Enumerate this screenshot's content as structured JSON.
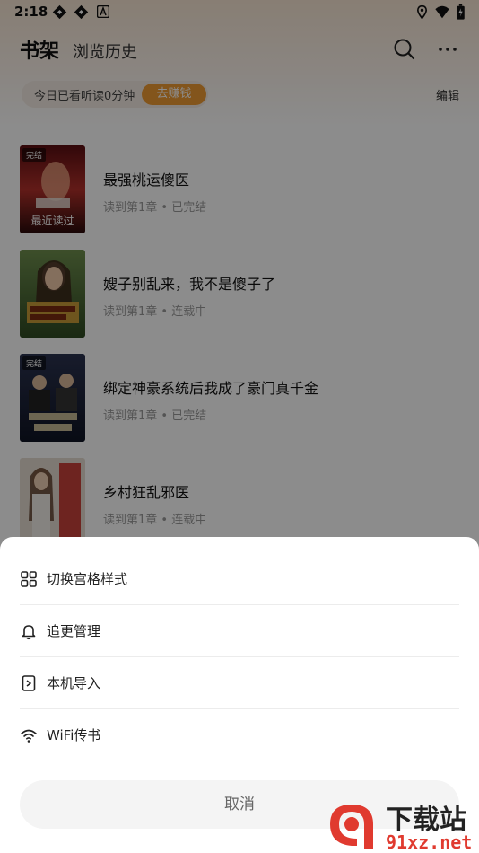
{
  "status_bar": {
    "time": "2:18",
    "left_icons": [
      "sync-icon",
      "sync-icon",
      "notification-a-icon"
    ],
    "right_icons": [
      "location-icon",
      "wifi-icon",
      "battery-icon"
    ]
  },
  "header": {
    "tab_active": "书架",
    "tab_inactive": "浏览历史",
    "search_icon": "search-icon",
    "more_icon": "more-icon"
  },
  "reading_banner": {
    "text": "今日已看听读0分钟",
    "button_label": "去赚钱",
    "button_color": "#ef9b34"
  },
  "edit_label": "编辑",
  "books": [
    {
      "title": "最强桃运傻医",
      "progress": "读到第1章 • 已完结",
      "badge": "完结",
      "cover_caption": "最近读过",
      "cover_color": "#8a1c1c"
    },
    {
      "title": "嫂子别乱来，我不是傻子了",
      "progress": "读到第1章 • 连载中",
      "badge": "",
      "cover_caption": "",
      "cover_color": "#3a5a2a"
    },
    {
      "title": "绑定神豪系统后我成了豪门真千金",
      "progress": "读到第1章 • 已完结",
      "badge": "完结",
      "cover_caption": "",
      "cover_color": "#1e2640"
    },
    {
      "title": "乡村狂乱邪医",
      "progress": "读到第1章 • 连载中",
      "badge": "",
      "cover_caption": "",
      "cover_color": "#c9a98a"
    }
  ],
  "sheet": {
    "items": [
      {
        "label": "切换宫格样式",
        "icon": "grid-icon"
      },
      {
        "label": "追更管理",
        "icon": "bell-icon"
      },
      {
        "label": "本机导入",
        "icon": "import-icon"
      },
      {
        "label": "WiFi传书",
        "icon": "wifi-icon"
      }
    ],
    "cancel_label": "取消"
  },
  "watermark": {
    "cn_text": "下载站",
    "en_text": "91xz.net"
  }
}
